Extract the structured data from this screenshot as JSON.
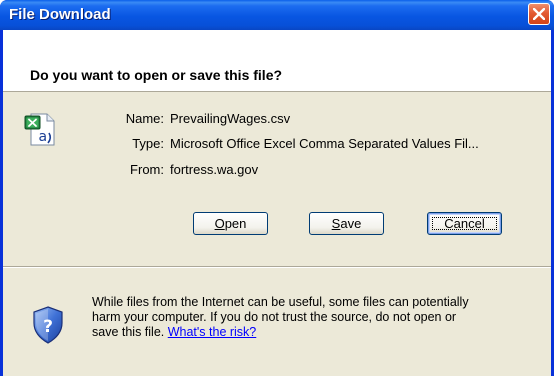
{
  "window": {
    "title": "File Download"
  },
  "dialog": {
    "question": "Do you want to open or save this file?",
    "file": {
      "icon": "excel-csv-file-icon",
      "name_label": "Name:",
      "name_value": "PrevailingWages.csv",
      "type_label": "Type:",
      "type_value": "Microsoft Office Excel Comma Separated Values Fil...",
      "from_label": "From:",
      "from_value": "fortress.wa.gov"
    },
    "buttons": {
      "open_prefix": "",
      "open_mnemonic": "O",
      "open_rest": "pen",
      "save_prefix": "",
      "save_mnemonic": "S",
      "save_rest": "ave",
      "cancel": "Cancel"
    },
    "warning": {
      "icon": "security-shield-icon",
      "line1": "While files from the Internet can be useful, some files can potentially",
      "line2": "harm your computer. If you do not trust the source, do not open or",
      "line3_prefix": "save this file. ",
      "link": "What's the risk?"
    }
  },
  "colors": {
    "titlebar": "#0856e2",
    "client_background": "#ece9d8",
    "link": "#0000ff",
    "close_button": "#e35a32"
  }
}
